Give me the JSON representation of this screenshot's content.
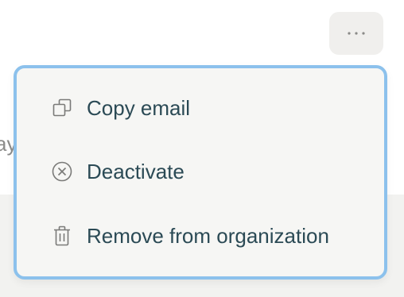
{
  "background": {
    "partial_text": "ay"
  },
  "more_button": {
    "icon": "more-horizontal-icon"
  },
  "menu": {
    "items": [
      {
        "label": "Copy email",
        "icon": "copy-icon"
      },
      {
        "label": "Deactivate",
        "icon": "circle-x-icon"
      },
      {
        "label": "Remove from organization",
        "icon": "trash-icon"
      }
    ]
  },
  "colors": {
    "menu_border": "#8cc1ec",
    "menu_background": "#f6f6f4",
    "label_text": "#2b4a55",
    "icon": "#7a7a78",
    "button_background": "#f0efed"
  }
}
